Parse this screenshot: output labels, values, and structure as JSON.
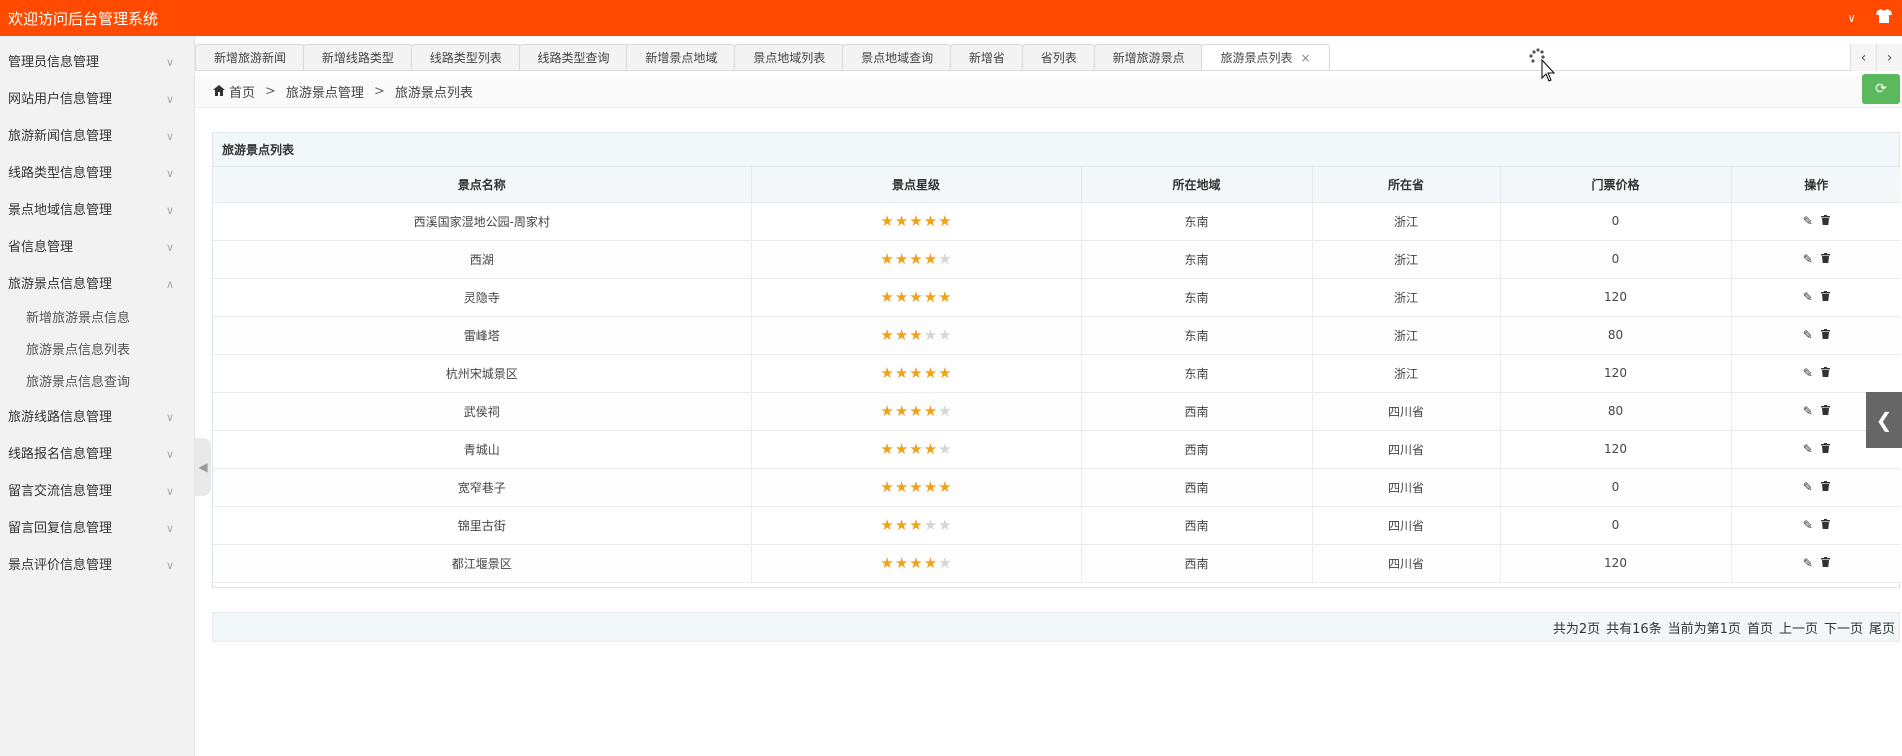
{
  "app": {
    "title": "欢迎访问后台管理系统"
  },
  "sidebar": {
    "items": [
      {
        "label": "管理员信息管理"
      },
      {
        "label": "网站用户信息管理"
      },
      {
        "label": "旅游新闻信息管理"
      },
      {
        "label": "线路类型信息管理"
      },
      {
        "label": "景点地域信息管理"
      },
      {
        "label": "省信息管理"
      },
      {
        "label": "旅游景点信息管理"
      },
      {
        "label": "旅游线路信息管理"
      },
      {
        "label": "线路报名信息管理"
      },
      {
        "label": "留言交流信息管理"
      },
      {
        "label": "留言回复信息管理"
      },
      {
        "label": "景点评价信息管理"
      }
    ],
    "sub_items": [
      {
        "label": "新增旅游景点信息"
      },
      {
        "label": "旅游景点信息列表"
      },
      {
        "label": "旅游景点信息查询"
      }
    ]
  },
  "tabs": [
    {
      "label": "新增旅游新闻"
    },
    {
      "label": "新增线路类型"
    },
    {
      "label": "线路类型列表"
    },
    {
      "label": "线路类型查询"
    },
    {
      "label": "新增景点地域"
    },
    {
      "label": "景点地域列表"
    },
    {
      "label": "景点地域查询"
    },
    {
      "label": "新增省"
    },
    {
      "label": "省列表"
    },
    {
      "label": "新增旅游景点"
    },
    {
      "label": "旅游景点列表"
    }
  ],
  "breadcrumb": {
    "home": "首页",
    "level1": "旅游景点管理",
    "level2": "旅游景点列表",
    "sep": ">"
  },
  "panel": {
    "title": "旅游景点列表",
    "columns": {
      "name": "景点名称",
      "stars": "景点星级",
      "region": "所在地域",
      "province": "所在省",
      "price": "门票价格",
      "ops": "操作"
    }
  },
  "rows": [
    {
      "name": "西溪国家湿地公园-周家村",
      "stars": 5,
      "region": "东南",
      "province": "浙江",
      "price": "0"
    },
    {
      "name": "西湖",
      "stars": 4,
      "region": "东南",
      "province": "浙江",
      "price": "0"
    },
    {
      "name": "灵隐寺",
      "stars": 5,
      "region": "东南",
      "province": "浙江",
      "price": "120"
    },
    {
      "name": "雷峰塔",
      "stars": 3,
      "region": "东南",
      "province": "浙江",
      "price": "80"
    },
    {
      "name": "杭州宋城景区",
      "stars": 5,
      "region": "东南",
      "province": "浙江",
      "price": "120"
    },
    {
      "name": "武侯祠",
      "stars": 4,
      "region": "西南",
      "province": "四川省",
      "price": "80"
    },
    {
      "name": "青城山",
      "stars": 4,
      "region": "西南",
      "province": "四川省",
      "price": "120"
    },
    {
      "name": "宽窄巷子",
      "stars": 5,
      "region": "西南",
      "province": "四川省",
      "price": "0"
    },
    {
      "name": "锦里古街",
      "stars": 3,
      "region": "西南",
      "province": "四川省",
      "price": "0"
    },
    {
      "name": "都江堰景区",
      "stars": 4,
      "region": "西南",
      "province": "四川省",
      "price": "120"
    }
  ],
  "pager": {
    "total_pages": "共为2页",
    "total_items": "共有16条",
    "current": "当前为第1页",
    "first": "首页",
    "prev": "上一页",
    "next": "下一页",
    "last": "尾页"
  },
  "colors": {
    "topbar": "#ff4a00",
    "refresh": "#5cb85c",
    "star_on": "#f0a21a",
    "star_off": "#d6d6d6"
  },
  "icons": {
    "home": "home-icon",
    "refresh": "refresh-icon",
    "edit": "pencil-icon",
    "delete": "trash-icon",
    "tab_prev": "chevron-left-icon",
    "tab_next": "chevron-right-icon",
    "shirt": "shirt-icon"
  }
}
